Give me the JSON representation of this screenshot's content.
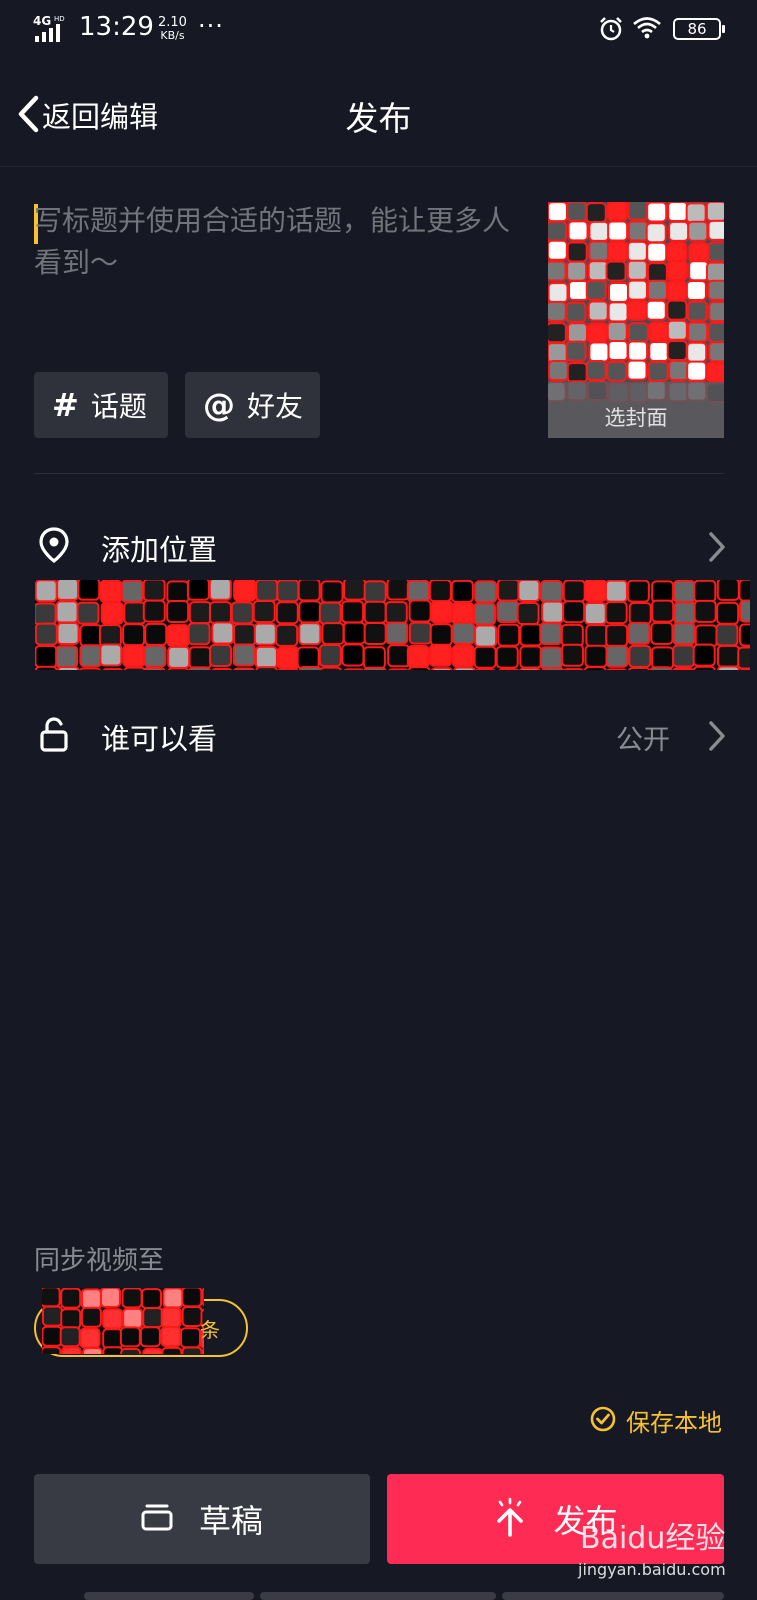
{
  "status_bar": {
    "network": "4G",
    "network_sup": "HD",
    "time": "13:29",
    "speed_value": "2.10",
    "speed_unit": "KB/s",
    "more": "···",
    "battery": "86"
  },
  "header": {
    "back_label": "返回编辑",
    "title": "发布"
  },
  "post": {
    "title_placeholder": "写标题并使用合适的话题，能让更多人看到～",
    "cover_label": "选封面"
  },
  "chips": {
    "topic_icon": "#",
    "topic_label": "话题",
    "friend_icon": "@",
    "friend_label": "好友"
  },
  "rows": {
    "location_label": "添加位置",
    "visibility_label": "谁可以看",
    "visibility_value": "公开"
  },
  "sync": {
    "label": "同步视频至",
    "pill_partial": "条"
  },
  "save_local": {
    "label": "保存本地",
    "checked": true
  },
  "buttons": {
    "draft_label": "草稿",
    "publish_label": "发布"
  },
  "watermark": {
    "brand": "Baidu经验",
    "url": "jingyan.baidu.com"
  },
  "colors": {
    "background": "#161823",
    "accent_yellow": "#f7c132",
    "publish_red": "#fe2c55",
    "chip_bg": "#2f313b",
    "muted_text": "#8a8b91"
  },
  "icons": {
    "back": "chevron-left-icon",
    "location": "location-pin-icon",
    "visibility": "unlock-icon",
    "row_chevron": "chevron-right-icon",
    "save_check": "check-circle-icon",
    "draft": "draft-box-icon",
    "publish": "publish-arrow-icon"
  }
}
